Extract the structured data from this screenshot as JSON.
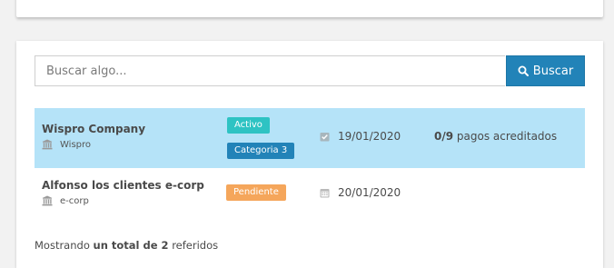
{
  "search": {
    "placeholder": "Buscar algo...",
    "button_label": "Buscar"
  },
  "rows": [
    {
      "name": "Wispro Company",
      "sub": "Wispro",
      "status": "Activo",
      "category": "Categoria 3",
      "date": "19/01/2020",
      "payments_count": "0/9",
      "payments_label": "pagos acreditados",
      "highlighted": true
    },
    {
      "name": "Alfonso los clientes e-corp",
      "sub": "e-corp",
      "status": "Pendiente",
      "date": "20/01/2020"
    }
  ],
  "footer": {
    "prefix": "Mostrando",
    "total": "un total de 2",
    "suffix": "referidos"
  },
  "colors": {
    "primary": "#2283b8",
    "highlight_row": "#b5e3f8",
    "badge_activo": "#2ec3c3",
    "badge_pendiente": "#f5a65b"
  },
  "icons": {
    "search_button": "search-icon",
    "company": "bank-icon",
    "date_checked": "calendar-check-icon",
    "date": "calendar-icon"
  }
}
